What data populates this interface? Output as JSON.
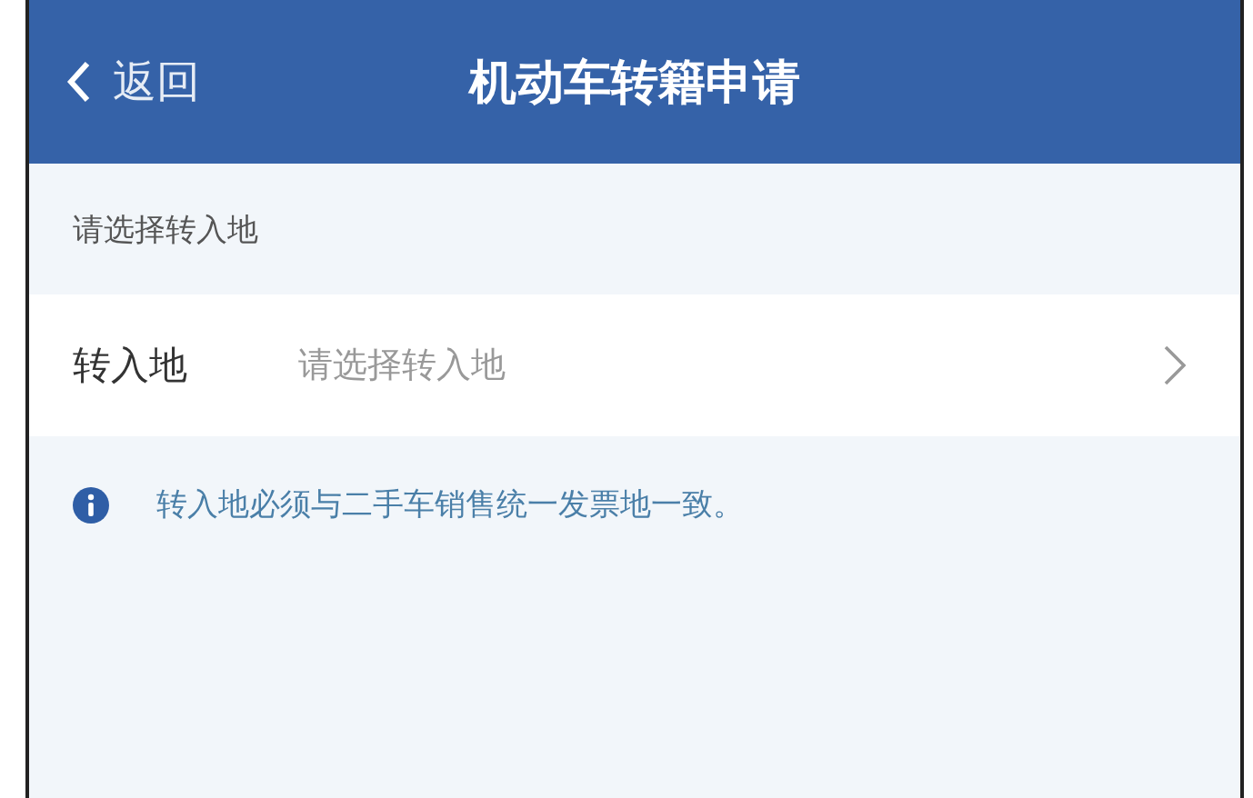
{
  "header": {
    "back": "返回",
    "title": "机动车转籍申请"
  },
  "section": {
    "title": "请选择转入地"
  },
  "field": {
    "label": "转入地",
    "placeholder": "请选择转入地"
  },
  "notice": {
    "text": "转入地必须与二手车销售统一发票地一致。"
  }
}
